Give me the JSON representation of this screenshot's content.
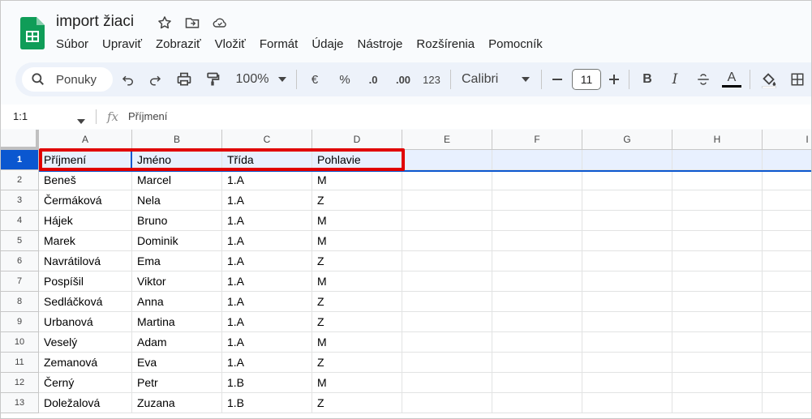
{
  "doc": {
    "title": "import žiaci"
  },
  "menu": [
    "Súbor",
    "Upraviť",
    "Zobraziť",
    "Vložiť",
    "Formát",
    "Údaje",
    "Nástroje",
    "Rozšírenia",
    "Pomocník"
  ],
  "toolbar": {
    "search_label": "Ponuky",
    "zoom": "100%",
    "currency": "€",
    "percent": "%",
    "dec_decrease": ".0",
    "dec_increase": ".00",
    "number_format": "123",
    "font": "Calibri",
    "font_size": "11",
    "bold": "B",
    "italic": "I",
    "text_color_letter": "A",
    "text_color": "#000000"
  },
  "formula_bar": {
    "name_box": "1:1",
    "fx": "fx",
    "value": "Příjmení"
  },
  "columns": [
    "A",
    "B",
    "C",
    "D",
    "E",
    "F",
    "G",
    "H",
    "I"
  ],
  "rows": [
    {
      "num": "1",
      "cells": [
        "Příjmení",
        "Jméno",
        "Třída",
        "Pohlavie"
      ]
    },
    {
      "num": "2",
      "cells": [
        "Beneš",
        "Marcel",
        "1.A",
        "M"
      ]
    },
    {
      "num": "3",
      "cells": [
        "Čermáková",
        "Nela",
        "1.A",
        "Z"
      ]
    },
    {
      "num": "4",
      "cells": [
        "Hájek",
        "Bruno",
        "1.A",
        "M"
      ]
    },
    {
      "num": "5",
      "cells": [
        "Marek",
        "Dominik",
        "1.A",
        "M"
      ]
    },
    {
      "num": "6",
      "cells": [
        "Navrátilová",
        "Ema",
        "1.A",
        "Z"
      ]
    },
    {
      "num": "7",
      "cells": [
        "Pospíšil",
        "Viktor",
        "1.A",
        "M"
      ]
    },
    {
      "num": "8",
      "cells": [
        "Sedláčková",
        "Anna",
        "1.A",
        "Z"
      ]
    },
    {
      "num": "9",
      "cells": [
        "Urbanová",
        "Martina",
        "1.A",
        "Z"
      ]
    },
    {
      "num": "10",
      "cells": [
        "Veselý",
        "Adam",
        "1.A",
        "M"
      ]
    },
    {
      "num": "11",
      "cells": [
        "Zemanová",
        "Eva",
        "1.A",
        "Z"
      ]
    },
    {
      "num": "12",
      "cells": [
        "Černý",
        "Petr",
        "1.B",
        "M"
      ]
    },
    {
      "num": "13",
      "cells": [
        "Doležalová",
        "Zuzana",
        "1.B",
        "Z"
      ]
    }
  ],
  "colors": {
    "accent": "#0b57d0",
    "sheets_green": "#0f9d58",
    "highlight_box": "#e00000"
  }
}
